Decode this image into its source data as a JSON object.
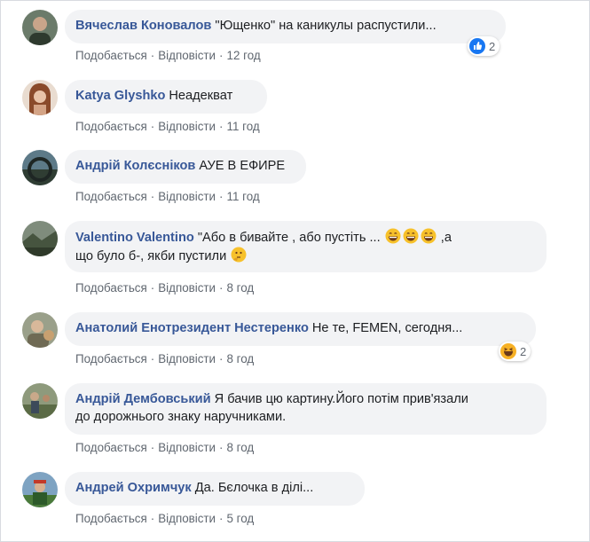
{
  "comments": [
    {
      "author": "Вячеслав Коновалов",
      "text": "\"Ющенко\" на каникулы распустили...",
      "like": "Подобається",
      "reply": "Відповісти",
      "time": "12 год",
      "reactions": "2"
    },
    {
      "author": "Katya Glyshko",
      "text": "Неадекват",
      "like": "Подобається",
      "reply": "Відповісти",
      "time": "11 год"
    },
    {
      "author": "Андрій Колєсніков",
      "text": "АУЕ В ЕФИРЕ",
      "like": "Подобається",
      "reply": "Відповісти",
      "time": "11 год"
    },
    {
      "author": "Valentino Valentino",
      "text_a": "\"Або в бивайте , або пустіть ...",
      "text_b": " ,а",
      "text_c": "що було б-, якби пустили",
      "like": "Подобається",
      "reply": "Відповісти",
      "time": "8 год"
    },
    {
      "author": "Анатолий Енотрезидент Нестеренко",
      "text": "Не те, FEMEN, сегодня...",
      "like": "Подобається",
      "reply": "Відповісти",
      "time": "8 год",
      "reactions": "2"
    },
    {
      "author": "Андрій Дембовський",
      "text_a": "Я бачив цю картину.Його потім прив'язали",
      "text_b": "до дорожнього знаку наручниками.",
      "like": "Подобається",
      "reply": "Відповісти",
      "time": "8 год"
    },
    {
      "author": "Андрей Охримчук",
      "text": "Да. Бєлочка в ділі...",
      "like": "Подобається",
      "reply": "Відповісти",
      "time": "5 год"
    }
  ],
  "colors": {
    "author": "#385898",
    "bubble": "#f2f3f5",
    "meta": "#606770",
    "like_reaction": "#1877f2",
    "haha_reaction": "#f7b125"
  },
  "icons": {
    "like_reaction": "thumbs-up-icon",
    "haha_reaction": "laughing-face-icon",
    "emoji_grin": "grinning-face-icon",
    "emoji_thinking": "thinking-face-icon"
  }
}
